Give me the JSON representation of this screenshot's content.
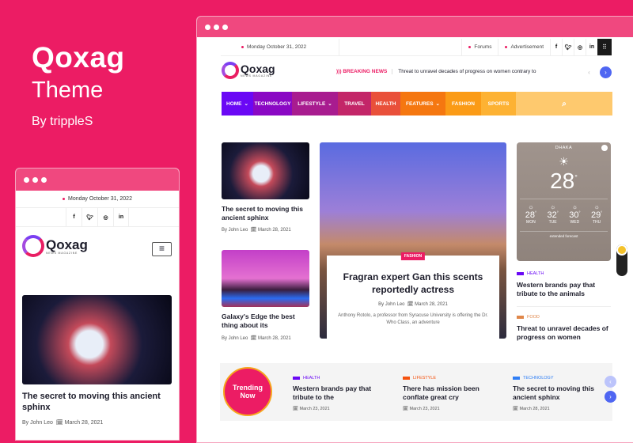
{
  "promo": {
    "title": "Qoxag",
    "subtitle": "Theme",
    "author": "By trippleS"
  },
  "desktop": {
    "topbar": {
      "date": "Monday October 31, 2022",
      "links": [
        "Forums",
        "Advertisement"
      ],
      "social": [
        "f",
        "t",
        "ig",
        "in"
      ]
    },
    "logo": {
      "name": "Qoxag",
      "tagline": "NEWS MAGAZINE"
    },
    "breaking": {
      "label": "BREAKING NEWS",
      "text": "Threat to unravel decades of progress on women contrary to"
    },
    "nav": [
      {
        "label": "HOME",
        "dropdown": true,
        "color": "#6a08f5"
      },
      {
        "label": "TECHNOLOGY",
        "dropdown": false,
        "color": "#8a08c4"
      },
      {
        "label": "LIFESTYLE",
        "dropdown": true,
        "color": "#a81c8f"
      },
      {
        "label": "TRAVEL",
        "dropdown": false,
        "color": "#c32668"
      },
      {
        "label": "HEALTH",
        "dropdown": false,
        "color": "#e9503a"
      },
      {
        "label": "FEATURES",
        "dropdown": true,
        "color": "#f57710"
      },
      {
        "label": "FASHION",
        "dropdown": false,
        "color": "#fb9b16"
      },
      {
        "label": "SPORTS",
        "dropdown": false,
        "color": "#fdb233"
      }
    ],
    "left_posts": [
      {
        "title": "The secret to moving this ancient sphinx",
        "author": "By John Leo",
        "date": "March 28, 2021"
      },
      {
        "title": "Galaxy's Edge the best thing about its",
        "author": "By John Leo",
        "date": "March 28, 2021"
      }
    ],
    "feature": {
      "category": "FASHION",
      "title": "Fragran expert Gan this scents reportedly actress",
      "author": "By John Leo",
      "date": "March 28, 2021",
      "excerpt": "Anthony Rotolo, a professor from Syracuse University is offering the Dr. Who Class, an adventure"
    },
    "weather": {
      "city": "DHAKA",
      "temp": "28",
      "unit": "°",
      "days": [
        {
          "temp": "28",
          "day": "MON"
        },
        {
          "temp": "32",
          "day": "TUE"
        },
        {
          "temp": "30",
          "day": "WED"
        },
        {
          "temp": "29",
          "day": "THU"
        }
      ],
      "footer": "extended forecast"
    },
    "side_posts": [
      {
        "category": "HEALTH",
        "color": "#6a08f5",
        "title": "Western brands pay that tribute to the animals"
      },
      {
        "category": "FOOD",
        "color": "#e0874a",
        "title": "Threat to unravel decades of progress on women"
      }
    ],
    "trending": {
      "label": "Trending Now",
      "items": [
        {
          "category": "HEALTH",
          "color": "#6a08f5",
          "title": "Western brands pay that tribute to the",
          "date": "March 23, 2021"
        },
        {
          "category": "LIFESTYLE",
          "color": "#f5520f",
          "title": "There has mission been conflate great cry",
          "date": "March 23, 2021"
        },
        {
          "category": "TECHNOLOGY",
          "color": "#2f7ef5",
          "title": "The secret to moving this ancient sphinx",
          "date": "March 28, 2021"
        }
      ]
    }
  },
  "mobile": {
    "date": "Monday October 31, 2022",
    "social": [
      "f",
      "t",
      "ig",
      "in"
    ],
    "logo": {
      "name": "Qoxag",
      "tagline": "NEWS MAGAZINE"
    },
    "post": {
      "title": "The secret to moving this ancient sphinx",
      "author": "By John Leo",
      "date": "March 28, 2021"
    }
  }
}
